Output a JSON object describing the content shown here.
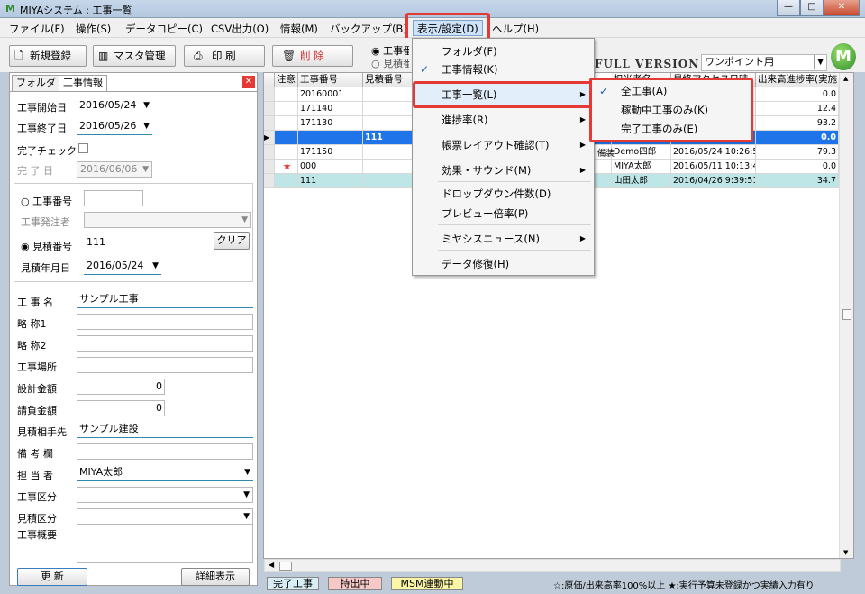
{
  "window": {
    "title": "MIYAシステム : 工事一覧",
    "logo": "M",
    "controls": {
      "min": "—",
      "max": "□",
      "close": "✕"
    }
  },
  "menubar": [
    {
      "label": "ファイル(F)"
    },
    {
      "label": "操作(S)"
    },
    {
      "label": "データコピー(C)"
    },
    {
      "label": "CSV出力(O)"
    },
    {
      "label": "情報(M)"
    },
    {
      "label": "バックアップ(B)"
    },
    {
      "label": "表示/設定(D)"
    },
    {
      "label": "ヘルプ(H)"
    }
  ],
  "toolbar": {
    "new": "新規登録",
    "master": "マスタ管理",
    "print": "印 刷",
    "delete": "削 除",
    "radio1": "工事番号",
    "radio2": "見積番号",
    "edition": "FULL VERSION",
    "mode_select": "ワンポイント用",
    "mode_arrow": "▼",
    "brand_logo": "M"
  },
  "left": {
    "tabs": [
      "フォルダ",
      "工事情報"
    ],
    "close": "✕",
    "start_label": "工事開始日",
    "start_value": "2016/05/24",
    "end_label": "工事終了日",
    "end_value": "2016/05/26",
    "complete_check": "完了チェック",
    "complete_date_label": "完 了 日",
    "complete_date_value": "2016/06/06",
    "radio_koji": "工事番号",
    "orderer_label": "工事発注者",
    "radio_mitsumori": "見積番号",
    "mitsumori_value": "111",
    "clear": "クリア",
    "mitsumori_date_label": "見積年月日",
    "mitsumori_date_value": "2016/05/24",
    "fields": [
      {
        "label": "工 事 名",
        "value": "サンプル工事"
      },
      {
        "label": "略 称1",
        "value": ""
      },
      {
        "label": "略 称2",
        "value": ""
      },
      {
        "label": "工事場所",
        "value": ""
      },
      {
        "label": "設計金額",
        "value": "0"
      },
      {
        "label": "請負金額",
        "value": "0"
      },
      {
        "label": "見積相手先",
        "value": "サンプル建設"
      },
      {
        "label": "備 考 欄",
        "value": ""
      },
      {
        "label": "担 当 者",
        "value": "MIYA太郎"
      },
      {
        "label": "工事区分",
        "value": ""
      },
      {
        "label": "見積区分",
        "value": ""
      },
      {
        "label": "工事概要",
        "value": ""
      }
    ],
    "update": "更 新",
    "detail": "詳細表示"
  },
  "grid": {
    "headers": [
      "注意",
      "工事番号",
      "見積番号",
      "担当者名",
      "最終アクセス日時",
      "出来高進捗率(実施"
    ],
    "rows": [
      {
        "flag": "",
        "koji": "20160001",
        "mitsu": "",
        "tan": "",
        "date": "",
        "rate": "0.0"
      },
      {
        "flag": "",
        "koji": "171140",
        "mitsu": "",
        "tan": "",
        "date": "",
        "rate": "12.4"
      },
      {
        "flag": "",
        "koji": "171130",
        "mitsu": "",
        "tan": "",
        "date": "",
        "rate": "93.2"
      },
      {
        "flag": "",
        "koji": "",
        "mitsu": "111",
        "tan": "",
        "date": "",
        "rate": "0.0"
      },
      {
        "flag": "",
        "koji": "171150",
        "mitsu": "",
        "tan": "Demo四郎",
        "date": "2016/05/24 10:26:5",
        "rate": "79.3"
      },
      {
        "flag": "★",
        "koji": "000",
        "mitsu": "",
        "tan": "MIYA太郎",
        "date": "2016/05/11 10:13:4",
        "rate": "0.0"
      },
      {
        "flag": "",
        "koji": "111",
        "mitsu": "",
        "tan": "山田太郎",
        "date": "2016/04/26 9:39:51",
        "rate": "34.7"
      }
    ],
    "partial": "備装"
  },
  "statusbar": {
    "done": "完了工事",
    "carry": "持出中",
    "msm": "MSM連動中",
    "legend": "☆:原価/出来高率100%以上 ★:実行予算未登録かつ実績入力有り"
  },
  "dropdown": {
    "items": [
      {
        "label": "フォルダ(F)",
        "checked": ""
      },
      {
        "label": "工事情報(K)",
        "checked": "✓"
      },
      {
        "label": "工事一覧(L)",
        "arrow": "▶"
      },
      {
        "label": "進捗率(R)",
        "arrow": "▶"
      },
      {
        "label": "帳票レイアウト確認(T)",
        "arrow": "▶"
      },
      {
        "label": "効果・サウンド(M)",
        "arrow": "▶"
      },
      {
        "label": "ドロップダウン件数(D)"
      },
      {
        "label": "プレビュー倍率(P)"
      },
      {
        "label": "ミヤシスニュース(N)",
        "arrow": "▶"
      },
      {
        "label": "データ修復(H)"
      }
    ]
  },
  "submenu": {
    "items": [
      {
        "label": "全工事(A)",
        "checked": "✓"
      },
      {
        "label": "稼動中工事のみ(K)",
        "checked": ""
      },
      {
        "label": "完了工事のみ(E)",
        "checked": ""
      }
    ]
  },
  "colors": {
    "highlight": "#1e74e8",
    "teal_row": "#bfe6e6",
    "annot_red": "#e53935"
  }
}
